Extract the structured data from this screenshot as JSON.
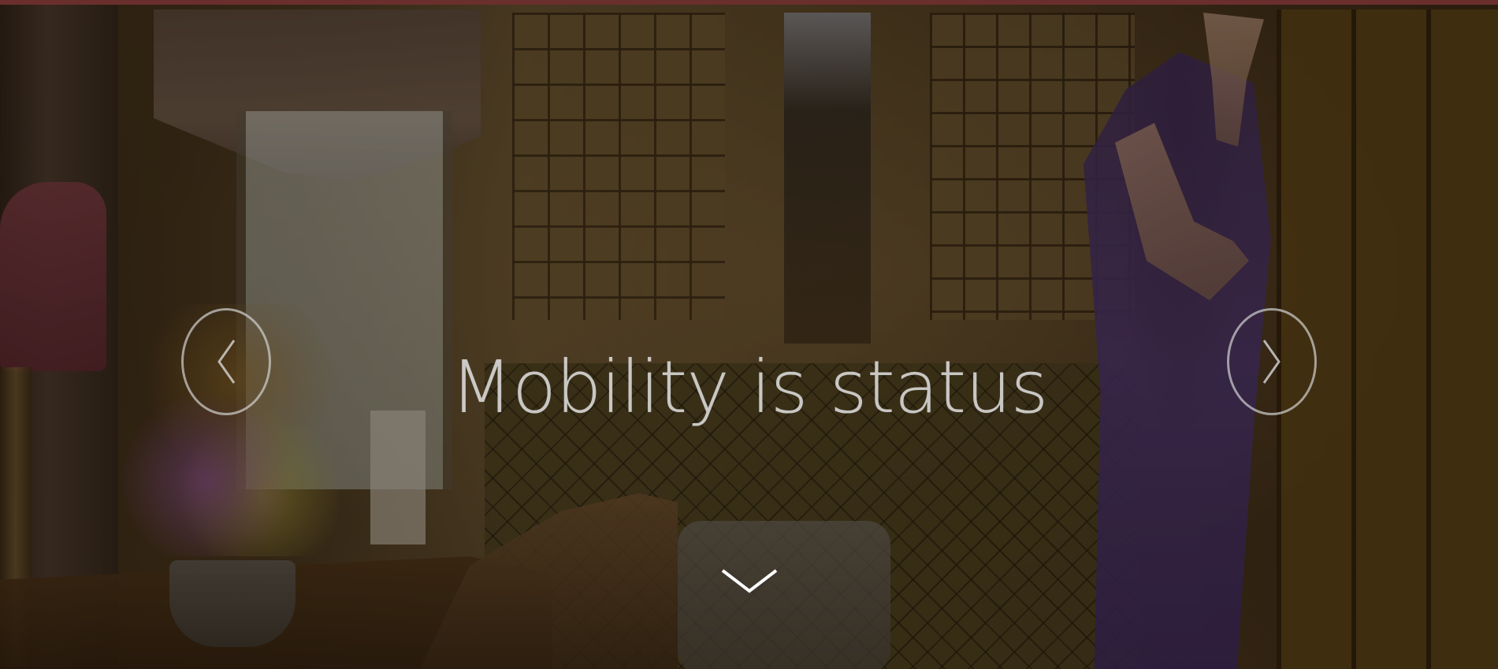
{
  "hero": {
    "headline": "Mobility is status"
  },
  "controls": {
    "prev_icon": "chevron-left-icon",
    "next_icon": "chevron-right-icon",
    "scroll_icon": "chevron-down-icon"
  },
  "colors": {
    "top_border": "#6a2f2c",
    "overlay_tint": "#140c04",
    "text": "#e1e1e1"
  }
}
